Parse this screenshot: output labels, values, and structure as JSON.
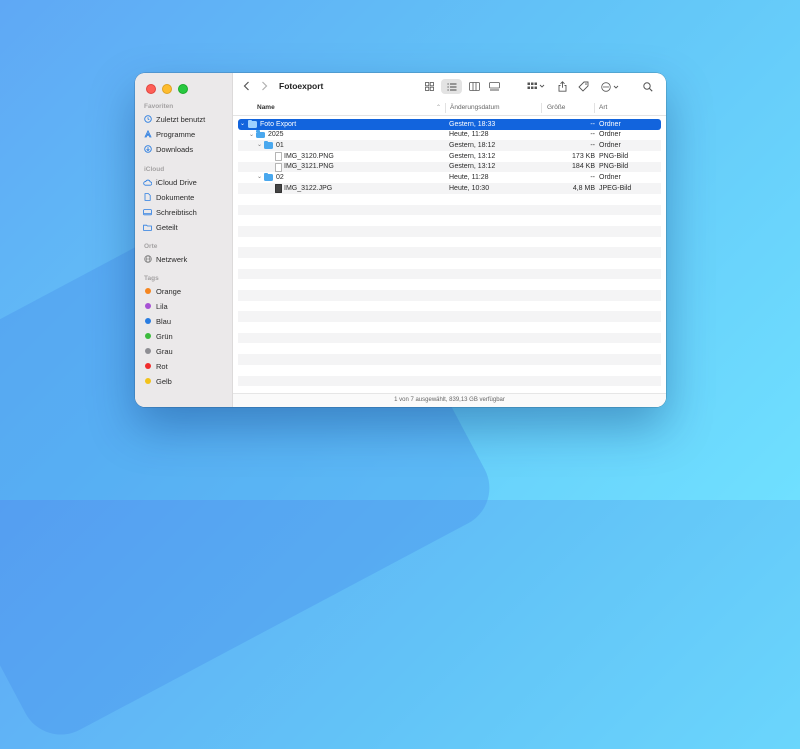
{
  "sidebar": {
    "favorites_title": "Favoriten",
    "favorites": [
      {
        "label": "Zuletzt benutzt",
        "icon": "clock-icon"
      },
      {
        "label": "Programme",
        "icon": "apps-icon"
      },
      {
        "label": "Downloads",
        "icon": "download-icon"
      }
    ],
    "icloud_title": "iCloud",
    "icloud": [
      {
        "label": "iCloud Drive",
        "icon": "cloud-icon"
      },
      {
        "label": "Dokumente",
        "icon": "document-icon"
      },
      {
        "label": "Schreibtisch",
        "icon": "desktop-icon"
      },
      {
        "label": "Geteilt",
        "icon": "shared-folder-icon"
      }
    ],
    "places_title": "Orte",
    "places": [
      {
        "label": "Netzwerk",
        "icon": "network-icon"
      }
    ],
    "tags_title": "Tags",
    "tags": [
      {
        "label": "Orange",
        "color": "#f5851f"
      },
      {
        "label": "Lila",
        "color": "#a752d4"
      },
      {
        "label": "Blau",
        "color": "#2a7de1"
      },
      {
        "label": "Grün",
        "color": "#3dbb3d"
      },
      {
        "label": "Grau",
        "color": "#8e8e93"
      },
      {
        "label": "Rot",
        "color": "#f02d2d"
      },
      {
        "label": "Gelb",
        "color": "#f2c21b"
      }
    ]
  },
  "toolbar": {
    "title": "Fotoexport",
    "back_icon": "chevron-left-icon",
    "forward_icon": "chevron-right-icon",
    "view_modes": [
      "icon-view-icon",
      "list-view-icon",
      "column-view-icon",
      "gallery-view-icon"
    ],
    "active_view": "list-view-icon"
  },
  "columns": {
    "name": "Name",
    "date": "Änderungsdatum",
    "size": "Größe",
    "kind": "Art"
  },
  "files": [
    {
      "name": "Foto Export",
      "date": "Gestern, 18:33",
      "size": "--",
      "kind": "Ordner",
      "type": "folder",
      "level": 0,
      "expanded": true,
      "selected": true
    },
    {
      "name": "2025",
      "date": "Heute, 11:28",
      "size": "--",
      "kind": "Ordner",
      "type": "folder",
      "level": 1,
      "expanded": true
    },
    {
      "name": "01",
      "date": "Gestern, 18:12",
      "size": "--",
      "kind": "Ordner",
      "type": "folder",
      "level": 2,
      "expanded": true
    },
    {
      "name": "IMG_3120.PNG",
      "date": "Gestern, 13:12",
      "size": "173 KB",
      "kind": "PNG-Bild",
      "type": "file",
      "level": 3
    },
    {
      "name": "IMG_3121.PNG",
      "date": "Gestern, 13:12",
      "size": "184 KB",
      "kind": "PNG-Bild",
      "type": "file",
      "level": 3
    },
    {
      "name": "02",
      "date": "Heute, 11:28",
      "size": "--",
      "kind": "Ordner",
      "type": "folder",
      "level": 2,
      "expanded": true
    },
    {
      "name": "IMG_3122.JPG",
      "date": "Heute, 10:30",
      "size": "4,8 MB",
      "kind": "JPEG-Bild",
      "type": "file-dark",
      "level": 3
    }
  ],
  "status_bar": "1 von 7 ausgewählt, 839,13 GB verfügbar"
}
